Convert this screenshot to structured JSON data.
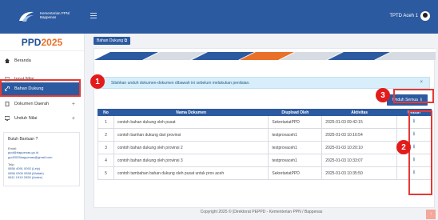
{
  "app": {
    "logo_text_line1": "Kementerian PPN/",
    "logo_text_line2": "Bappenas",
    "brand_prefix": "PPD",
    "brand_year": "2025",
    "user_name": "TPTD Aceh 1"
  },
  "sidebar": {
    "items": [
      {
        "label": "Beranda",
        "icon": "home-icon"
      },
      {
        "label": "Input Nilai",
        "icon": "keyboard-icon"
      },
      {
        "label": "Bahan Dukung",
        "icon": "link-icon",
        "active": true
      },
      {
        "label": "Dokumen Daerah",
        "icon": "copy-icon",
        "expand": "+"
      },
      {
        "label": "Unduh Nilai",
        "icon": "monitor-icon",
        "expand": "+"
      }
    ],
    "help": {
      "title": "Butuh Bantuan ?",
      "email_label": "Email:",
      "emails": [
        "ppd@bappenas.go.id",
        "ppd2025bappenas@gmail.com"
      ],
      "tel_label": "Telp:",
      "phones": [
        "0856 4091 0092 (Lely)",
        "0856 0305 0558 (Mutiah)",
        "0811 1919 2928 (Andre)"
      ]
    }
  },
  "main": {
    "tab_label": "Bahan Dukung",
    "alert_text": "Silahkan unduh dokumen-dokumen dibawah ini sebelum melakukan penilaian.",
    "alert_close": "×",
    "download_all_label": "Unduh Semua",
    "columns": [
      "No",
      "Nama Dokumen",
      "Diupload Oleh",
      "Aktivitas",
      "Unduh"
    ],
    "rows": [
      {
        "no": "1",
        "name": "contoh bahan dukung oleh pusat",
        "by": "SekretariatPPD",
        "time": "2025-01-03 09:42:15"
      },
      {
        "no": "2",
        "name": "contoh banhan dukung dari provinsi",
        "by": "testprovaceh1",
        "time": "2025-01-03 10:16:54"
      },
      {
        "no": "3",
        "name": "contoh bahan dukung oleh provinsi 2",
        "by": "testprovaceh1",
        "time": "2025-01-03 10:20:10"
      },
      {
        "no": "4",
        "name": "contoh bahan dukung oleh provinsi 3",
        "by": "testprovaceh1",
        "time": "2025-01-03 10:33:07"
      },
      {
        "no": "5",
        "name": "contoh tambahan bahan dukung oleh pusat untuk prov aceh",
        "by": "SekretariatPPD",
        "time": "2025-01-03 10:35:50"
      }
    ]
  },
  "annotations": {
    "n1": "1",
    "n2": "2",
    "n3": "3"
  },
  "footer": {
    "text": "Copyright 2025 © |Direktorat PEPPD - Kementerian PPN / Bappenas",
    "up": "↑"
  },
  "colors": {
    "primary": "#2c5aa0",
    "accent": "#e8712a",
    "annotation": "#e31b1b"
  }
}
